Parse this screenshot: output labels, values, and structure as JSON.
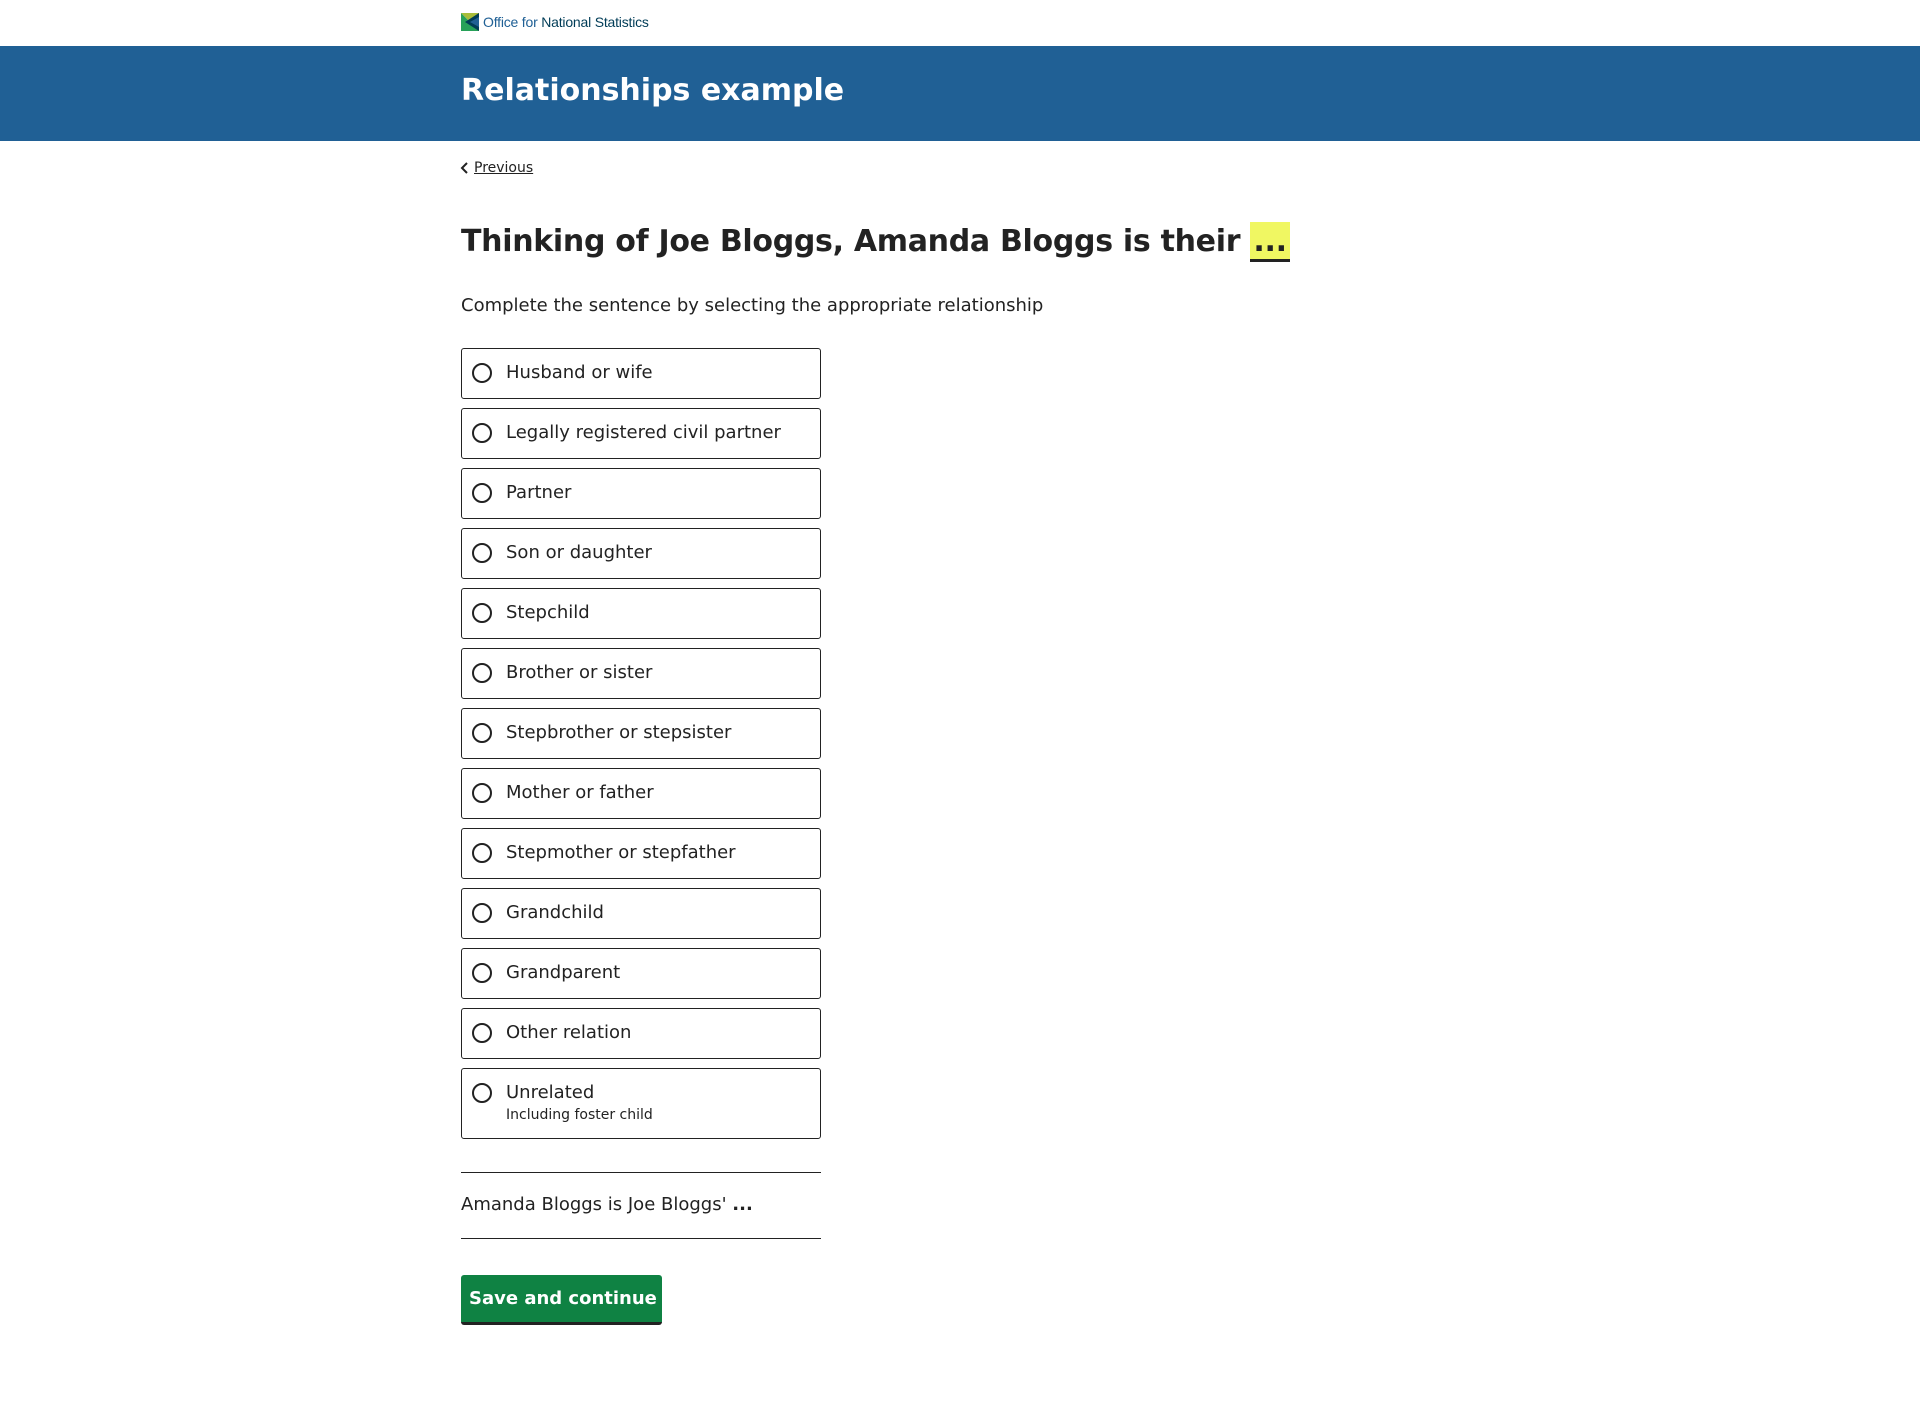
{
  "logo": {
    "text_light": "Office for",
    "text_bold": "National Statistics",
    "brand_color": "#206095",
    "icon": "ons-logo-icon"
  },
  "header": {
    "title": "Relationships example",
    "background_color": "#206095"
  },
  "nav": {
    "previous_label": "Previous",
    "previous_icon": "chevron-left-icon"
  },
  "question": {
    "title": "Thinking of Joe Bloggs, Amanda Bloggs is their",
    "placeholder": "...",
    "placeholder_color": "#f0f762",
    "hint": "Complete the sentence by selecting the appropriate relationship"
  },
  "options": [
    {
      "label": "Husband or wife"
    },
    {
      "label": "Legally registered civil partner"
    },
    {
      "label": "Partner"
    },
    {
      "label": "Son or daughter"
    },
    {
      "label": "Stepchild"
    },
    {
      "label": "Brother or sister"
    },
    {
      "label": "Stepbrother or stepsister"
    },
    {
      "label": "Mother or father"
    },
    {
      "label": "Stepmother or stepfather"
    },
    {
      "label": "Grandchild"
    },
    {
      "label": "Grandparent"
    },
    {
      "label": "Other relation"
    },
    {
      "label": "Unrelated",
      "description": "Including foster child"
    }
  ],
  "playback": {
    "text": "Amanda Bloggs is Joe Bloggs'",
    "ellipsis": "..."
  },
  "actions": {
    "save_label": "Save and continue",
    "button_color": "#0f8243"
  }
}
